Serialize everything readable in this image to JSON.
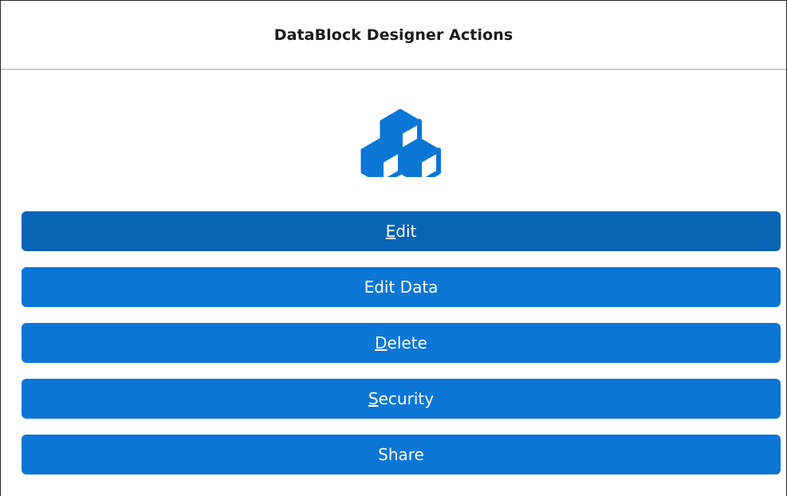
{
  "dialog": {
    "title": "DataBlock Designer Actions",
    "icon": "datablock-cubes-icon"
  },
  "actions": [
    {
      "id": "edit",
      "mnemonic": "E",
      "rest": "dit",
      "state": "active"
    },
    {
      "id": "edit-data",
      "mnemonic": "",
      "rest": "Edit Data",
      "state": "normal"
    },
    {
      "id": "delete",
      "mnemonic": "D",
      "rest": "elete",
      "state": "normal"
    },
    {
      "id": "security",
      "mnemonic": "S",
      "rest": "ecurity",
      "state": "normal"
    },
    {
      "id": "share",
      "mnemonic": "",
      "rest": "Share",
      "state": "normal"
    }
  ],
  "colors": {
    "button": "#0a76d6",
    "button_active": "#0764b4",
    "icon": "#0a76d6"
  }
}
